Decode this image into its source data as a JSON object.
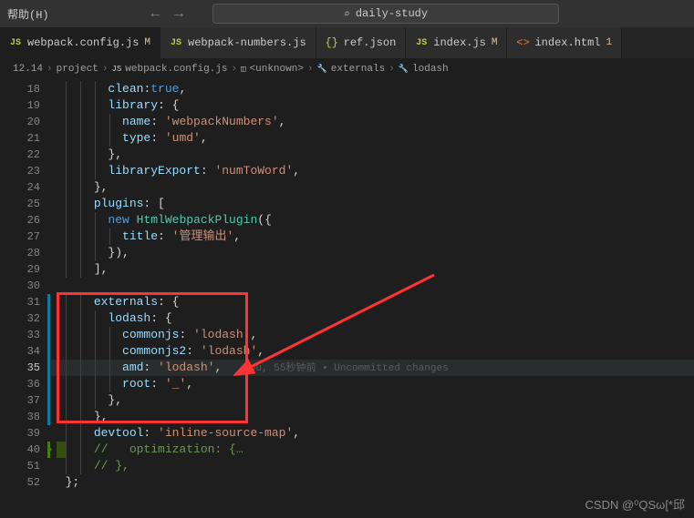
{
  "menu": {
    "help": "帮助(H)"
  },
  "nav": {
    "back": "←",
    "forward": "→"
  },
  "search": {
    "placeholder": "daily-study"
  },
  "tabs": [
    {
      "icon": "JS",
      "label": "webpack.config.js",
      "status": "M",
      "active": true
    },
    {
      "icon": "JS",
      "label": "webpack-numbers.js",
      "status": "",
      "active": false
    },
    {
      "icon": "{}",
      "label": "ref.json",
      "status": "",
      "active": false
    },
    {
      "icon": "JS",
      "label": "index.js",
      "status": "M",
      "active": false
    },
    {
      "icon": "<>",
      "label": "index.html",
      "status": "1",
      "active": false
    }
  ],
  "breadcrumb": [
    "12.14",
    "project",
    "webpack.config.js",
    "<unknown>",
    "externals",
    "lodash"
  ],
  "lines": {
    "start": 18,
    "code": {
      "18": {
        "indent": 3,
        "tokens": [
          [
            "prop",
            "clean"
          ],
          [
            "punc",
            ":"
          ],
          [
            "bool",
            "true"
          ],
          [
            "punc",
            ","
          ]
        ]
      },
      "19": {
        "indent": 3,
        "tokens": [
          [
            "prop",
            "library"
          ],
          [
            "punc",
            ": {"
          ]
        ]
      },
      "20": {
        "indent": 4,
        "tokens": [
          [
            "prop",
            "name"
          ],
          [
            "punc",
            ": "
          ],
          [
            "string",
            "'webpackNumbers'"
          ],
          [
            "punc",
            ","
          ]
        ]
      },
      "21": {
        "indent": 4,
        "tokens": [
          [
            "prop",
            "type"
          ],
          [
            "punc",
            ": "
          ],
          [
            "string",
            "'umd'"
          ],
          [
            "punc",
            ","
          ]
        ]
      },
      "22": {
        "indent": 3,
        "tokens": [
          [
            "punc",
            "},"
          ]
        ]
      },
      "23": {
        "indent": 3,
        "tokens": [
          [
            "prop",
            "libraryExport"
          ],
          [
            "punc",
            ": "
          ],
          [
            "string",
            "'numToWord'"
          ],
          [
            "punc",
            ","
          ]
        ]
      },
      "24": {
        "indent": 2,
        "tokens": [
          [
            "punc",
            "},"
          ]
        ]
      },
      "25": {
        "indent": 2,
        "tokens": [
          [
            "prop",
            "plugins"
          ],
          [
            "punc",
            ": ["
          ]
        ]
      },
      "26": {
        "indent": 3,
        "tokens": [
          [
            "keyword",
            "new "
          ],
          [
            "class-name",
            "HtmlWebpackPlugin"
          ],
          [
            "punc",
            "({"
          ]
        ]
      },
      "27": {
        "indent": 4,
        "tokens": [
          [
            "prop",
            "title"
          ],
          [
            "punc",
            ": "
          ],
          [
            "string",
            "'管理输出'"
          ],
          [
            "punc",
            ","
          ]
        ]
      },
      "28": {
        "indent": 3,
        "tokens": [
          [
            "punc",
            "}),"
          ]
        ]
      },
      "29": {
        "indent": 2,
        "tokens": [
          [
            "punc",
            "],"
          ]
        ]
      },
      "30": {
        "indent": 0,
        "tokens": []
      },
      "31": {
        "indent": 2,
        "tokens": [
          [
            "prop",
            "externals"
          ],
          [
            "punc",
            ": {"
          ]
        ],
        "git": "mod"
      },
      "32": {
        "indent": 3,
        "tokens": [
          [
            "prop",
            "lodash"
          ],
          [
            "punc",
            ": {"
          ]
        ],
        "git": "mod"
      },
      "33": {
        "indent": 4,
        "tokens": [
          [
            "prop",
            "commonjs"
          ],
          [
            "punc",
            ": "
          ],
          [
            "string",
            "'lodash'"
          ],
          [
            "punc",
            ","
          ]
        ],
        "git": "mod"
      },
      "34": {
        "indent": 4,
        "tokens": [
          [
            "prop",
            "commonjs2"
          ],
          [
            "punc",
            ": "
          ],
          [
            "string",
            "'lodash'"
          ],
          [
            "punc",
            ","
          ]
        ],
        "git": "mod"
      },
      "35": {
        "indent": 4,
        "tokens": [
          [
            "prop",
            "amd"
          ],
          [
            "punc",
            ": "
          ],
          [
            "string",
            "'lodash'"
          ],
          [
            "punc",
            ","
          ]
        ],
        "git": "mod",
        "current": true,
        "blame": "You, 55秒钟前 • Uncommitted changes"
      },
      "36": {
        "indent": 4,
        "tokens": [
          [
            "prop",
            "root"
          ],
          [
            "punc",
            ": "
          ],
          [
            "string",
            "'_'"
          ],
          [
            "punc",
            ","
          ]
        ],
        "git": "mod"
      },
      "37": {
        "indent": 3,
        "tokens": [
          [
            "punc",
            "},"
          ]
        ],
        "git": "mod"
      },
      "38": {
        "indent": 2,
        "tokens": [
          [
            "punc",
            "},"
          ]
        ],
        "git": "mod"
      },
      "39": {
        "indent": 2,
        "tokens": [
          [
            "prop",
            "devtool"
          ],
          [
            "punc",
            ": "
          ],
          [
            "string",
            "'inline-source-map'"
          ],
          [
            "punc",
            ","
          ]
        ]
      },
      "40": {
        "indent": 2,
        "tokens": [
          [
            "comment",
            "//   optimization: {…"
          ]
        ],
        "git": "add",
        "folded": true
      },
      "51": {
        "indent": 2,
        "tokens": [
          [
            "comment",
            "// },"
          ]
        ]
      },
      "52": {
        "indent": 0,
        "tokens": [
          [
            "punc",
            "};"
          ]
        ]
      }
    },
    "order": [
      "18",
      "19",
      "20",
      "21",
      "22",
      "23",
      "24",
      "25",
      "26",
      "27",
      "28",
      "29",
      "30",
      "31",
      "32",
      "33",
      "34",
      "35",
      "36",
      "37",
      "38",
      "39",
      "40",
      "51",
      "52"
    ]
  },
  "watermark": "CSDN @⁰QSω[*邱"
}
